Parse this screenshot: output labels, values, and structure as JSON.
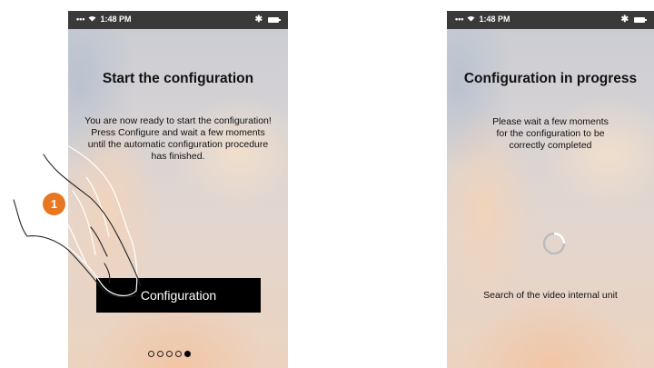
{
  "screen1": {
    "status": {
      "time": "1:48 PM"
    },
    "title": "Start the configuration",
    "body": "You are now ready to start the configuration!\nPress Configure and wait a few moments\nuntil the automatic configuration procedure\nhas finished.",
    "button_label": "Configuration",
    "pager": {
      "total": 5,
      "active_index": 4
    }
  },
  "screen2": {
    "status": {
      "time": "1:48 PM"
    },
    "title": "Configuration in progress",
    "body": "Please wait a few moments\nfor the configuration to be\ncorrectly completed",
    "search_text": "Search of the video internal unit"
  },
  "annotation": {
    "step_number": "1",
    "color": "#e87722"
  }
}
